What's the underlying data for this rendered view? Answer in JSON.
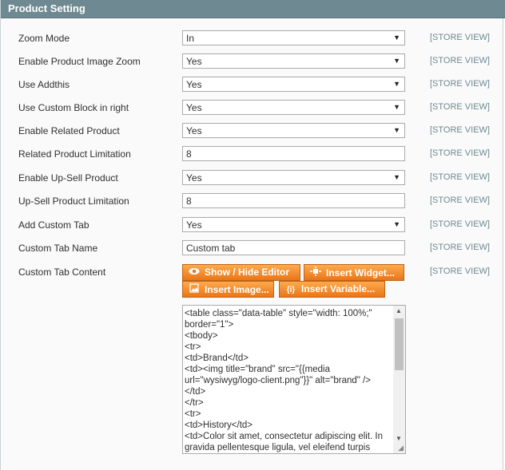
{
  "section": {
    "title": "Product Setting"
  },
  "scope_label": "[STORE VIEW]",
  "fields": [
    {
      "label": "Zoom Mode",
      "type": "select",
      "value": "In"
    },
    {
      "label": "Enable Product Image Zoom",
      "type": "select",
      "value": "Yes"
    },
    {
      "label": "Use Addthis",
      "type": "select",
      "value": "Yes"
    },
    {
      "label": "Use Custom Block in right",
      "type": "select",
      "value": "Yes"
    },
    {
      "label": "Enable Related Product",
      "type": "select",
      "value": "Yes"
    },
    {
      "label": "Related Product Limitation",
      "type": "input",
      "value": "8"
    },
    {
      "label": "Enable Up-Sell Product",
      "type": "select",
      "value": "Yes"
    },
    {
      "label": "Up-Sell Product Limitation",
      "type": "input",
      "value": "8"
    },
    {
      "label": "Add Custom Tab",
      "type": "select",
      "value": "Yes"
    },
    {
      "label": "Custom Tab Name",
      "type": "input",
      "value": "Custom tab"
    }
  ],
  "custom_tab_content": {
    "label": "Custom Tab Content",
    "buttons": {
      "show_hide": "Show / Hide Editor",
      "insert_widget": "Insert Widget...",
      "insert_image": "Insert Image...",
      "insert_variable": "Insert Variable..."
    },
    "text": "<table class=\"data-table\" style=\"width: 100%;\" border=\"1\">\n<tbody>\n<tr>\n<td>Brand</td>\n<td><img title=\"brand\" src=\"{{media url=\"wysiwyg/logo-client.png\"}}\" alt=\"brand\" />\n</td>\n</tr>\n<tr>\n<td>History</td>\n<td>Color sit amet, consectetur adipiscing elit. In gravida pellentesque ligula, vel eleifend turpis"
  },
  "icons": {
    "dropdown": "chevron-down-icon",
    "eye": "eye-icon",
    "widget": "widget-icon",
    "image": "image-icon",
    "variable": "variable-icon"
  }
}
